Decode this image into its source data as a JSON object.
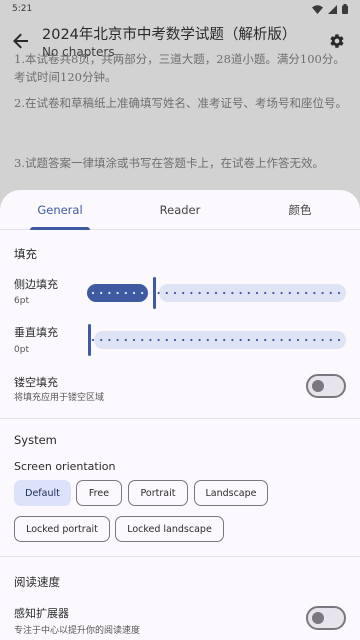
{
  "status": {
    "time": "5:21"
  },
  "app": {
    "title": "2024年北京市中考数学试题（解析版）",
    "subtitle": "No chapters"
  },
  "background_text": [
    "1.本试卷共8页，共两部分，三道大题，28道小题。满分100分。考试时间120分钟。",
    "2.在试卷和草稿纸上准确填写姓名、准考证号、考场号和座位号。",
    "3.试题答案一律填涂或书写在答题卡上，在试卷上作答无效。"
  ],
  "tabs": [
    {
      "label": "General",
      "active": true
    },
    {
      "label": "Reader",
      "active": false
    },
    {
      "label": "颜色",
      "active": false
    }
  ],
  "padding": {
    "section_title": "填充",
    "horizontal": {
      "label": "侧边填充",
      "value_text": "6pt",
      "fraction": 0.25
    },
    "vertical": {
      "label": "垂直填充",
      "value_text": "0pt",
      "fraction": 0.0
    },
    "cutout": {
      "label": "镂空填充",
      "description": "将填充应用于镂空区域",
      "enabled": false
    }
  },
  "system": {
    "section_title": "System",
    "orientation_label": "Screen orientation",
    "options": [
      {
        "label": "Default",
        "selected": true
      },
      {
        "label": "Free",
        "selected": false
      },
      {
        "label": "Portrait",
        "selected": false
      },
      {
        "label": "Landscape",
        "selected": false
      },
      {
        "label": "Locked portrait",
        "selected": false
      },
      {
        "label": "Locked landscape",
        "selected": false
      }
    ]
  },
  "reading_speed": {
    "section_title": "阅读速度",
    "expander": {
      "label": "感知扩展器",
      "description": "专注于中心以提升你的阅读速度",
      "enabled": false
    }
  },
  "colors": {
    "accent": "#3f5aa0",
    "track_inactive": "#dee3f6",
    "chip_selected": "#dbe2f9",
    "sheet_bg": "#fbf8fe"
  }
}
